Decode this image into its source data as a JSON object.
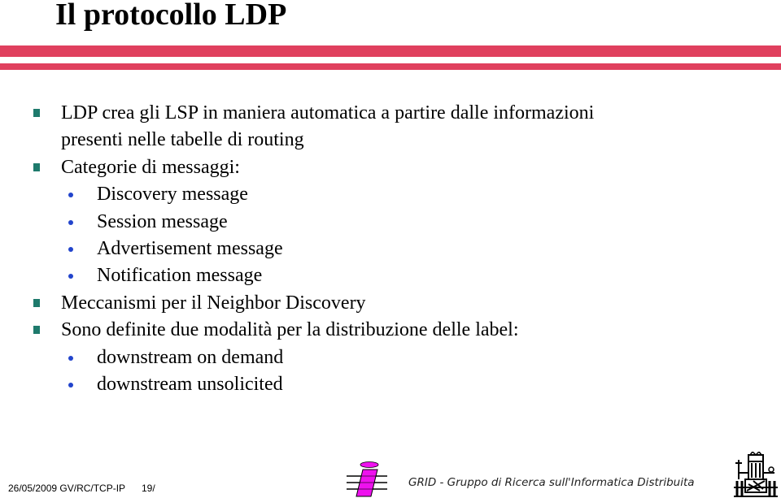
{
  "slide": {
    "title": "Il protocollo LDP",
    "accent_color": "#e0405e",
    "bullet_square_color": "#1e7a6c",
    "bullet_dot_color": "#2244cc",
    "items": [
      {
        "level": 1,
        "lines": [
          "LDP crea gli LSP in maniera automatica a partire dalle informazioni",
          "presenti nelle tabelle di routing"
        ]
      },
      {
        "level": 1,
        "lines": [
          "Categorie di messaggi:"
        ]
      },
      {
        "level": 2,
        "lines": [
          "Discovery message"
        ]
      },
      {
        "level": 2,
        "lines": [
          "Session message"
        ]
      },
      {
        "level": 2,
        "lines": [
          "Advertisement message"
        ]
      },
      {
        "level": 2,
        "lines": [
          "Notification message"
        ]
      },
      {
        "level": 1,
        "lines": [
          "Meccanismi per il Neighbor Discovery"
        ]
      },
      {
        "level": 1,
        "lines": [
          "Sono definite due modalità per la distribuzione delle label:"
        ]
      },
      {
        "level": 2,
        "lines": [
          "downstream on demand"
        ]
      },
      {
        "level": 2,
        "lines": [
          "downstream unsolicited"
        ]
      }
    ]
  },
  "footer": {
    "date_code": "26/05/2009 GV/RC/TCP-IP",
    "page": "19/",
    "group_name": "GRID - Gruppo di Ricerca sull'Informatica Distribuita",
    "logo_left": "informatica-logo-icon",
    "logo_right": "university-crest-icon",
    "logo_color": "#ee11ee"
  }
}
